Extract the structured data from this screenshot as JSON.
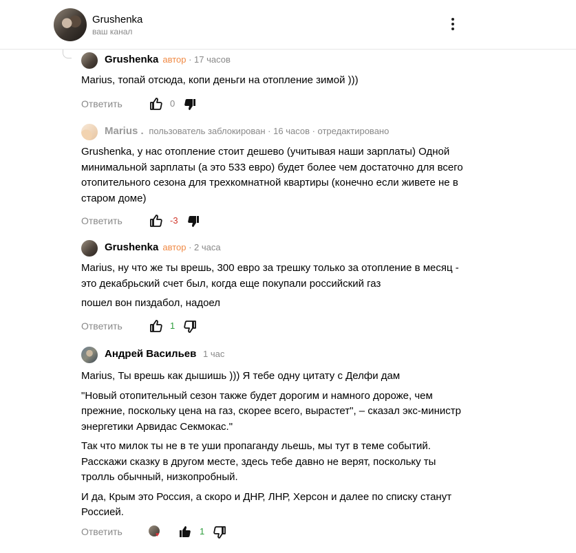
{
  "channel": {
    "name": "Grushenka",
    "subtitle": "ваш канал"
  },
  "reply_label": "Ответить",
  "comments": [
    {
      "author": "Grushenka",
      "badge": "автор",
      "meta": " · 17 часов",
      "text": [
        "Marius, топай отсюда, копи деньги на отопление зимой )))"
      ],
      "likes": "0"
    },
    {
      "author": "Marius .",
      "meta": "пользователь заблокирован · 16 часов · отредактировано",
      "text": [
        "Grushenka, у нас отопление стоит дешево (учитывая наши зарплаты) Одной минимальной зарплаты (а это 533 евро) будет более чем достаточно для всего отопительного сезона для трехкомнатной квартиры (конечно если живете не в старом доме)"
      ],
      "likes": "-3"
    },
    {
      "author": "Grushenka",
      "badge": "автор",
      "meta": " · 2 часа",
      "text": [
        "Marius, ну что же ты врешь, 300 евро за трешку только за отопление в месяц - это декабрьский счет был, когда еще покупали российский газ",
        "пошел вон пиздабол, надоел"
      ],
      "likes": "1"
    },
    {
      "author": "Андрей Васильев",
      "meta": "1 час",
      "text": [
        "Marius, Ты врешь как дышишь ))) Я тебе одну цитату с Делфи дам",
        "\"Новый отопительный сезон также будет дорогим и намного дороже, чем прежние, поскольку цена на газ, скорее всего, вырастет\", – сказал экс-министр энергетики Арвидас Секмокас.\"",
        "Так что милок ты не в те уши пропаганду льешь, мы тут в теме событий. Расскажи сказку в другом месте, здесь тебе давно не верят, поскольку ты тролль обычный, низкопробный.",
        "И да, Крым это Россия, а скоро и ДНР, ЛНР, Херсон и далее по списку станут Россией."
      ],
      "likes": "1",
      "heart": "♥"
    }
  ]
}
